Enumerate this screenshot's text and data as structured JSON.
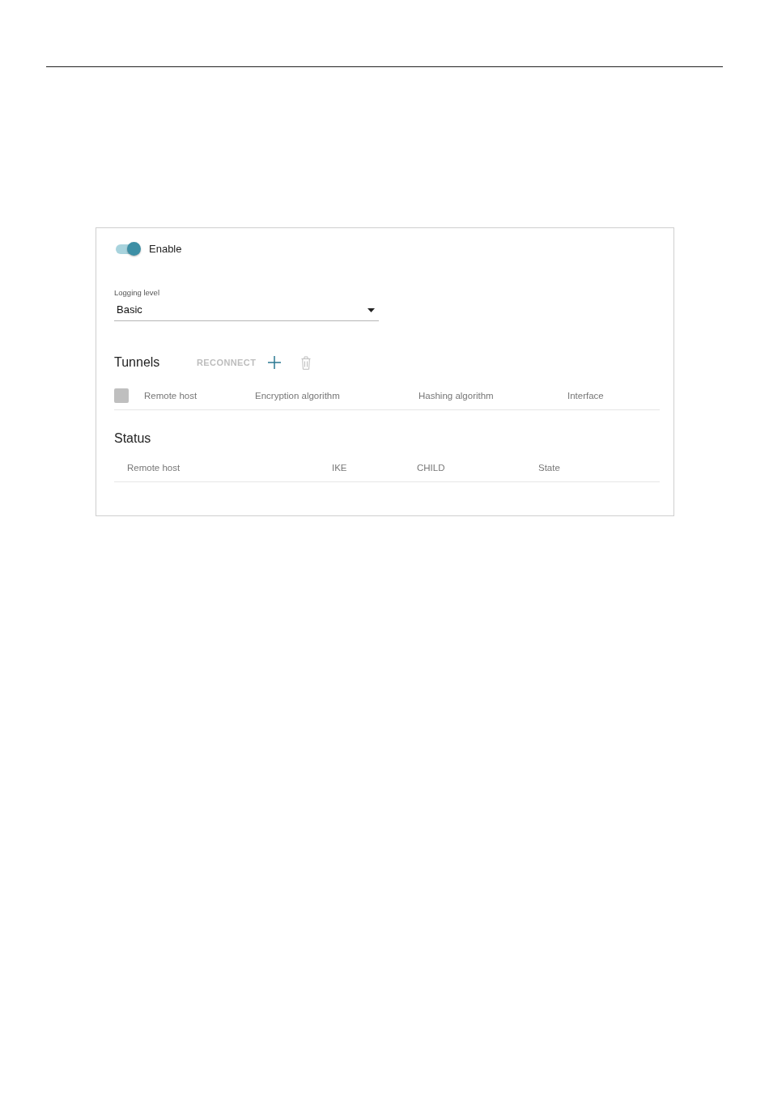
{
  "toggle": {
    "label": "Enable",
    "on": true
  },
  "logging_level": {
    "label": "Logging level",
    "value": "Basic"
  },
  "tunnels": {
    "title": "Tunnels",
    "actions": [
      {
        "kind": "text",
        "label": "RECONNECT",
        "disabled": true
      },
      {
        "kind": "add",
        "disabled": false
      },
      {
        "kind": "delete",
        "disabled": true
      }
    ],
    "select_all": {
      "checked": false,
      "disabled": true
    },
    "columns": [
      "Remote host",
      "Encryption algorithm",
      "Hashing algorithm",
      "Interface"
    ]
  },
  "status": {
    "title": "Status",
    "columns": [
      "Remote host",
      "IKE",
      "CHILD",
      "State"
    ]
  }
}
